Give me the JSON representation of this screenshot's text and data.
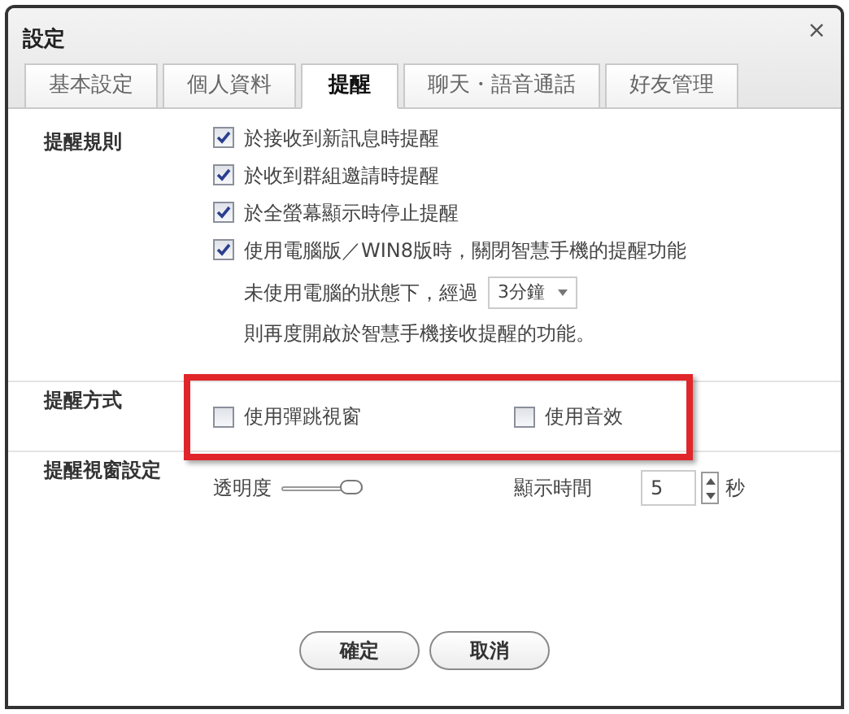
{
  "window": {
    "title": "設定",
    "close": "×"
  },
  "tabs": [
    {
      "label": "基本設定",
      "selected": false
    },
    {
      "label": "個人資料",
      "selected": false
    },
    {
      "label": "提醒",
      "selected": true
    },
    {
      "label": "聊天・語音通話",
      "selected": false
    },
    {
      "label": "好友管理",
      "selected": false
    }
  ],
  "rules": {
    "label": "提醒規則",
    "options": [
      {
        "label": "於接收到新訊息時提醒",
        "checked": true
      },
      {
        "label": "於收到群組邀請時提醒",
        "checked": true
      },
      {
        "label": "於全螢幕顯示時停止提醒",
        "checked": true
      },
      {
        "label": "使用電腦版／WIN8版時，關閉智慧手機的提醒功能",
        "checked": true
      }
    ],
    "idle_prefix": "未使用電腦的狀態下，經過",
    "idle_value": "3分鐘",
    "idle_suffix": "則再度開啟於智慧手機接收提醒的功能。"
  },
  "method": {
    "label": "提醒方式",
    "highlighted": true,
    "options": [
      {
        "label": "使用彈跳視窗",
        "checked": false
      },
      {
        "label": "使用音效",
        "checked": false
      }
    ]
  },
  "popup": {
    "label": "提醒視窗設定",
    "opacity_label": "透明度",
    "opacity": {
      "level": 1
    },
    "duration_label": "顯示時間",
    "duration_value": "5",
    "duration_unit": "秒"
  },
  "buttons": [
    "確定",
    "取消"
  ]
}
